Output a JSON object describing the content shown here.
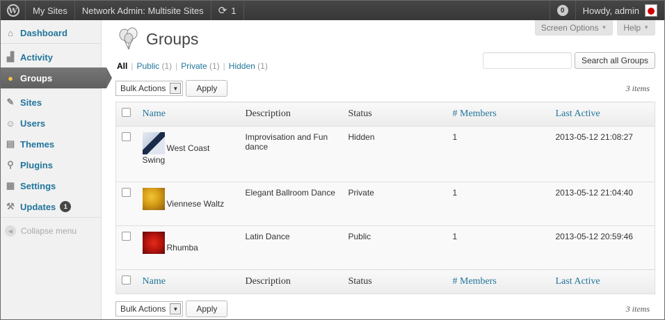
{
  "adminbar": {
    "logo": "wordpress-logo",
    "my_sites": "My Sites",
    "network_admin": "Network Admin: Multisite Sites",
    "updates_count": "1",
    "notifications": "0",
    "howdy": "Howdy, admin"
  },
  "sidebar": {
    "items": [
      {
        "label": "Dashboard",
        "icon": "home-icon"
      },
      {
        "label": "Activity",
        "icon": "activity-icon"
      },
      {
        "label": "Groups",
        "icon": "groups-icon"
      },
      {
        "label": "Sites",
        "icon": "sites-icon"
      },
      {
        "label": "Users",
        "icon": "users-icon"
      },
      {
        "label": "Themes",
        "icon": "themes-icon"
      },
      {
        "label": "Plugins",
        "icon": "plugins-icon"
      },
      {
        "label": "Settings",
        "icon": "settings-icon"
      },
      {
        "label": "Updates",
        "icon": "updates-icon",
        "badge": "1"
      }
    ],
    "collapse": "Collapse menu",
    "current_color": "#6a6a6a"
  },
  "header": {
    "screen_options": "Screen Options",
    "help": "Help",
    "title": "Groups"
  },
  "filters": {
    "all": "All",
    "public": "Public",
    "public_count": "(1)",
    "private": "Private",
    "private_count": "(1)",
    "hidden": "Hidden",
    "hidden_count": "(1)"
  },
  "search": {
    "button": "Search all Groups",
    "value": ""
  },
  "tablenav": {
    "bulk_actions": "Bulk Actions",
    "apply": "Apply",
    "items": "3 items"
  },
  "table": {
    "columns": [
      "Name",
      "Description",
      "Status",
      "# Members",
      "Last Active"
    ],
    "rows": [
      {
        "name": "West Coast Swing",
        "description": "Improvisation and Fun dance",
        "status": "Hidden",
        "members": "1",
        "last_active": "2013-05-12 21:08:27"
      },
      {
        "name": "Viennese Waltz",
        "description": "Elegant Ballroom Dance",
        "status": "Private",
        "members": "1",
        "last_active": "2013-05-12 21:04:40"
      },
      {
        "name": "Rhumba",
        "description": "Latin Dance",
        "status": "Public",
        "members": "1",
        "last_active": "2013-05-12 20:59:46"
      }
    ]
  },
  "colors": {
    "link": "#21759b",
    "adminbar": "#464646"
  }
}
